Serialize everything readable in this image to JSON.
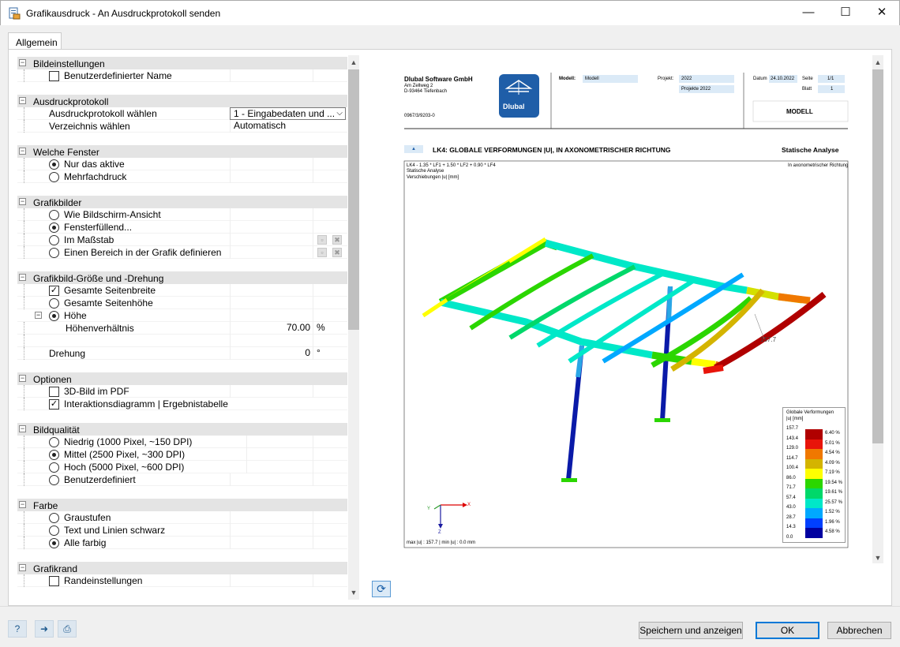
{
  "window": {
    "title": "Grafikausdruck - An Ausdruckprotokoll senden",
    "minimize": "—",
    "maximize": "☐",
    "close": "✕"
  },
  "tabs": [
    {
      "label": "Allgemein"
    }
  ],
  "sections": {
    "bildeinstellungen": {
      "title": "Bildeinstellungen",
      "benutzerdefinierter_name": {
        "label": "Benutzerdefinierter Name",
        "checked": false
      }
    },
    "ausdruckprotokoll": {
      "title": "Ausdruckprotokoll",
      "waehlen": {
        "label": "Ausdruckprotokoll wählen",
        "value": "1 - Eingabedaten und ..."
      },
      "verzeichnis": {
        "label": "Verzeichnis wählen",
        "value": "Automatisch"
      }
    },
    "welche_fenster": {
      "title": "Welche Fenster",
      "options": [
        "Nur das aktive",
        "Mehrfachdruck"
      ],
      "selected": 0
    },
    "grafikbilder": {
      "title": "Grafikbilder",
      "options": [
        "Wie Bildschirm-Ansicht",
        "Fensterfüllend...",
        "Im Maßstab",
        "Einen Bereich in der Grafik definieren"
      ],
      "selected": 1
    },
    "groesse": {
      "title": "Grafikbild-Größe und -Drehung",
      "gesamte_seitenbreite": {
        "label": "Gesamte Seitenbreite",
        "checked": true
      },
      "gesamte_seitenhoehe": "Gesamte Seitenhöhe",
      "hoehe": "Höhe",
      "hoehenverhaeltnis": {
        "label": "Höhenverhältnis",
        "value": "70.00",
        "unit": "%"
      },
      "drehung": {
        "label": "Drehung",
        "value": "0",
        "unit": "°"
      }
    },
    "optionen": {
      "title": "Optionen",
      "pdf3d": {
        "label": "3D-Bild im PDF",
        "checked": false
      },
      "interaktion": {
        "label": "Interaktionsdiagramm | Ergebnistabelle",
        "checked": true
      }
    },
    "bildqualitaet": {
      "title": "Bildqualität",
      "options": [
        "Niedrig (1000 Pixel, ~150 DPI)",
        "Mittel (2500 Pixel, ~300 DPI)",
        "Hoch (5000 Pixel, ~600 DPI)",
        "Benutzerdefiniert"
      ],
      "selected": 1
    },
    "farbe": {
      "title": "Farbe",
      "options": [
        "Graustufen",
        "Text und Linien schwarz",
        "Alle farbig"
      ],
      "selected": 2
    },
    "grafikrand": {
      "title": "Grafikrand",
      "randeinstellungen": {
        "label": "Randeinstellungen",
        "checked": false
      }
    }
  },
  "preview": {
    "company": "Dlubal Software GmbH",
    "address1": "Am Zellweg 2",
    "address2": "D-93464 Tiefenbach",
    "code": "0967/3/9203-0",
    "logo_text": "Dlubal",
    "modell_label": "Modell:",
    "modell_value": "Modell",
    "projekt_label": "Projekt:",
    "projekt_value1": "2022",
    "projekt_value2": "Projekte 2022",
    "datum_label": "Datum",
    "datum_value": "24.10.2022",
    "seite_label": "Seite",
    "seite_value": "1/1",
    "blatt_label": "Blatt",
    "blatt_value": "1",
    "modell_box": "MODELL",
    "heading_marker": "▲",
    "heading": "LK4: GLOBALE VERFORMUNGEN |U|, IN AXONOMETRISCHER RICHTUNG",
    "heading_right": "Statische Analyse",
    "info1": "LK4 - 1.35 * LF1 + 1.50 * LF2 + 0.90 * LF4",
    "info2": "Statische Analyse",
    "info3": "Verschiebungen |u| [mm]",
    "info_right": "In axonometrischer Richtung",
    "annotation": "157.7",
    "footer": "max |u| : 157.7 | min |u| : 0.0 mm",
    "axis_x": "X",
    "axis_y": "Y",
    "axis_z": "Z",
    "legend": {
      "title1": "Globale Verformungen",
      "title2": "|u| [mm]",
      "values": [
        "157.7",
        "143.4",
        "129.0",
        "114.7",
        "100.4",
        "86.0",
        "71.7",
        "57.4",
        "43.0",
        "28.7",
        "14.3",
        "0.0"
      ],
      "percents": [
        "6.40 %",
        "5.01 %",
        "4.54 %",
        "4.09 %",
        "7.19 %",
        "19.54 %",
        "19.61 %",
        "25.57 %",
        "1.52 %",
        "1.96 %",
        "4.58 %"
      ],
      "colors": [
        "#b00000",
        "#e8140a",
        "#f07800",
        "#d4b400",
        "#ffff00",
        "#2bd600",
        "#00d86a",
        "#00e8c8",
        "#00a8ff",
        "#0040ff",
        "#0000a0"
      ]
    }
  },
  "buttons": {
    "save_show": "Speichern und anzeigen",
    "ok": "OK",
    "cancel": "Abbrechen"
  },
  "icons": {
    "help": "help-icon",
    "send": "send-icon",
    "print": "print-settings-icon",
    "refresh": "refresh-icon"
  }
}
